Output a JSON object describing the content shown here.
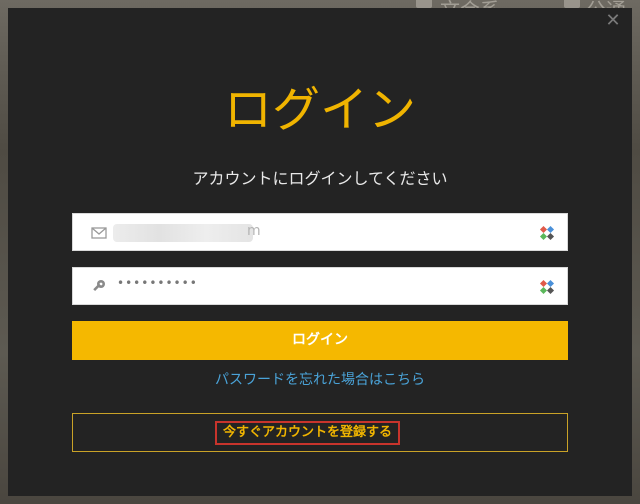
{
  "background": {
    "label_1": "文会系",
    "label_2": "公通"
  },
  "modal": {
    "title": "ログイン",
    "subtitle": "アカウントにログインしてください",
    "email": {
      "visible_tail": "m"
    },
    "password": {
      "masked_value": "••••••••••"
    },
    "login_button_label": "ログイン",
    "forgot_link": "パスワードを忘れた場合はこちら",
    "register_label": "今すぐアカウントを登録する"
  },
  "colors": {
    "accent": "#f5b800",
    "title": "#f0b400",
    "link": "#4aa3d8",
    "modal_bg": "#232323",
    "highlight_box": "#c8342c"
  },
  "icons": {
    "email_field": "envelope-icon",
    "password_field": "key-icon",
    "field_extension": "password-manager-icon",
    "close": "close-icon"
  }
}
